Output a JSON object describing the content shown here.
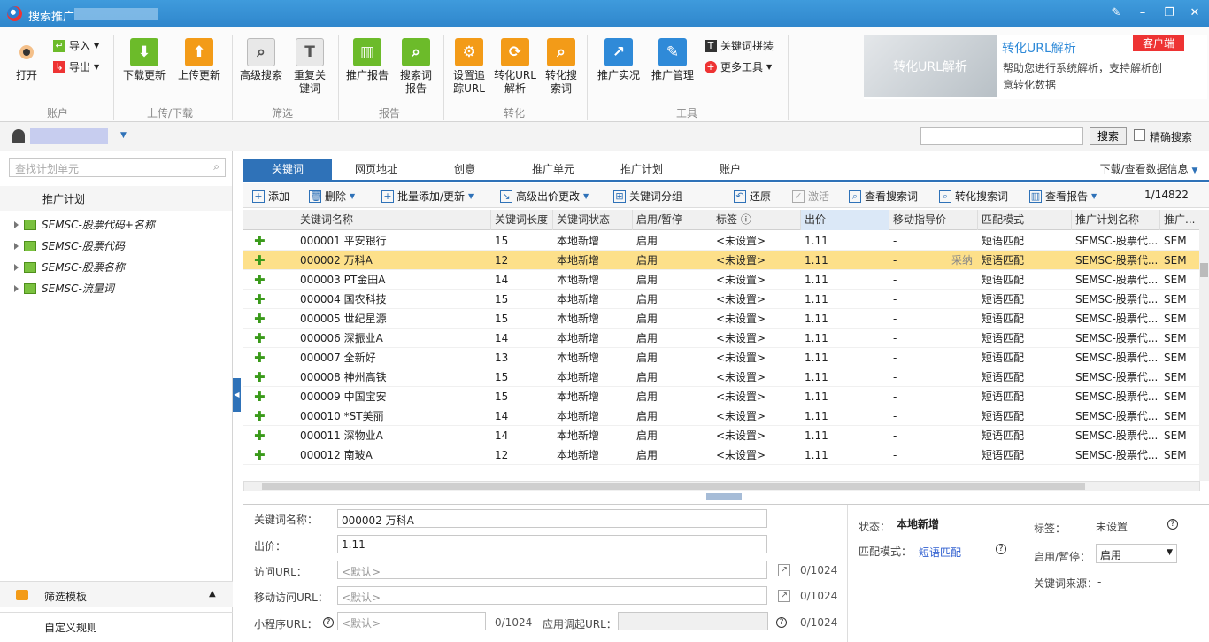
{
  "window": {
    "title": "搜索推广"
  },
  "ribbon": {
    "account": {
      "open": "打开",
      "import": "导入",
      "export": "导出",
      "label": "账户"
    },
    "updown": {
      "download": "下载更新",
      "upload": "上传更新",
      "label": "上传/下载"
    },
    "filter": {
      "adv_search": "高级搜索",
      "dup_kw": "重复关键词",
      "label": "筛选"
    },
    "report": {
      "promo_report": "推广报告",
      "search_report": "搜索词报告",
      "label": "报告"
    },
    "convert": {
      "track": "设置追踪URL",
      "url_parse": "转化URL解析",
      "conv_search": "转化搜索词",
      "label": "转化"
    },
    "tools": {
      "live": "推广实况",
      "manage": "推广管理",
      "kw_splice": "关键词拼装",
      "more": "更多工具",
      "label": "工具"
    },
    "ad": {
      "image_text": "转化URL解析",
      "title": "转化URL解析",
      "text": "帮助您进行系统解析，支持解析创意转化数据",
      "tag": "客户端"
    }
  },
  "userbar": {
    "search_btn": "搜索",
    "exact": "精确搜索"
  },
  "left": {
    "search_placeholder": "查找计划单元",
    "header": "推广计划",
    "plans": [
      "SEMSC-股票代码+名称",
      "SEMSC-股票代码",
      "SEMSC-股票名称",
      "SEMSC-流量词"
    ],
    "filter_tpl": "筛选模板",
    "custom_rule": "自定义规则"
  },
  "tabs": [
    "关键词",
    "网页地址",
    "创意",
    "推广单元",
    "推广计划",
    "账户"
  ],
  "download_info": "下载/查看数据信息",
  "toolbar": {
    "add": "添加",
    "delete": "删除",
    "batch": "批量添加/更新",
    "bid": "高级出价更改",
    "group": "关键词分组",
    "restore": "还原",
    "activate": "激活",
    "view_search": "查看搜索词",
    "conv_search": "转化搜索词",
    "view_report": "查看报告",
    "paging": "1/14822"
  },
  "columns": [
    "关键词名称",
    "关键词长度",
    "关键词状态",
    "启用/暂停",
    "标签",
    "出价",
    "移动指导价",
    "匹配模式",
    "推广计划名称",
    "推广..."
  ],
  "rows": [
    [
      "000001 平安银行",
      "15",
      "本地新增",
      "启用",
      "<未设置>",
      "1.11",
      "-",
      "短语匹配",
      "SEMSC-股票代...",
      "SEM"
    ],
    [
      "000002 万科A",
      "12",
      "本地新增",
      "启用",
      "<未设置>",
      "1.11",
      "-",
      "短语匹配",
      "SEMSC-股票代...",
      "SEM"
    ],
    [
      "000003 PT金田A",
      "14",
      "本地新增",
      "启用",
      "<未设置>",
      "1.11",
      "-",
      "短语匹配",
      "SEMSC-股票代...",
      "SEM"
    ],
    [
      "000004 国农科技",
      "15",
      "本地新增",
      "启用",
      "<未设置>",
      "1.11",
      "-",
      "短语匹配",
      "SEMSC-股票代...",
      "SEM"
    ],
    [
      "000005 世纪星源",
      "15",
      "本地新增",
      "启用",
      "<未设置>",
      "1.11",
      "-",
      "短语匹配",
      "SEMSC-股票代...",
      "SEM"
    ],
    [
      "000006 深振业A",
      "14",
      "本地新增",
      "启用",
      "<未设置>",
      "1.11",
      "-",
      "短语匹配",
      "SEMSC-股票代...",
      "SEM"
    ],
    [
      "000007 全新好",
      "13",
      "本地新增",
      "启用",
      "<未设置>",
      "1.11",
      "-",
      "短语匹配",
      "SEMSC-股票代...",
      "SEM"
    ],
    [
      "000008 神州高铁",
      "15",
      "本地新增",
      "启用",
      "<未设置>",
      "1.11",
      "-",
      "短语匹配",
      "SEMSC-股票代...",
      "SEM"
    ],
    [
      "000009 中国宝安",
      "15",
      "本地新增",
      "启用",
      "<未设置>",
      "1.11",
      "-",
      "短语匹配",
      "SEMSC-股票代...",
      "SEM"
    ],
    [
      "000010 *ST美丽",
      "14",
      "本地新增",
      "启用",
      "<未设置>",
      "1.11",
      "-",
      "短语匹配",
      "SEMSC-股票代...",
      "SEM"
    ],
    [
      "000011 深物业A",
      "14",
      "本地新增",
      "启用",
      "<未设置>",
      "1.11",
      "-",
      "短语匹配",
      "SEMSC-股票代...",
      "SEM"
    ],
    [
      "000012 南玻A",
      "12",
      "本地新增",
      "启用",
      "<未设置>",
      "1.11",
      "-",
      "短语匹配",
      "SEMSC-股票代...",
      "SEM"
    ]
  ],
  "adopt": "采纳",
  "detail": {
    "kw_label": "关键词名称：",
    "kw_value": "000002 万科A",
    "bid_label": "出价：",
    "bid_value": "1.11",
    "url_label": "访问URL：",
    "murl_label": "移动访问URL：",
    "mini_label": "小程序URL：",
    "app_label": "应用调起URL：",
    "default": "<默认>",
    "cnt1": "0/1024",
    "cnt2": "0/1024",
    "cnt3": "0/1024",
    "cnt4": "0/1024",
    "status_label": "状态：",
    "status_value": "本地新增",
    "match_label": "匹配模式：",
    "match_value": "短语匹配",
    "tag_label": "标签：",
    "tag_value": "未设置",
    "pause_label": "启用/暂停：",
    "pause_value": "启用",
    "source_label": "关键词来源：",
    "source_value": "-"
  }
}
